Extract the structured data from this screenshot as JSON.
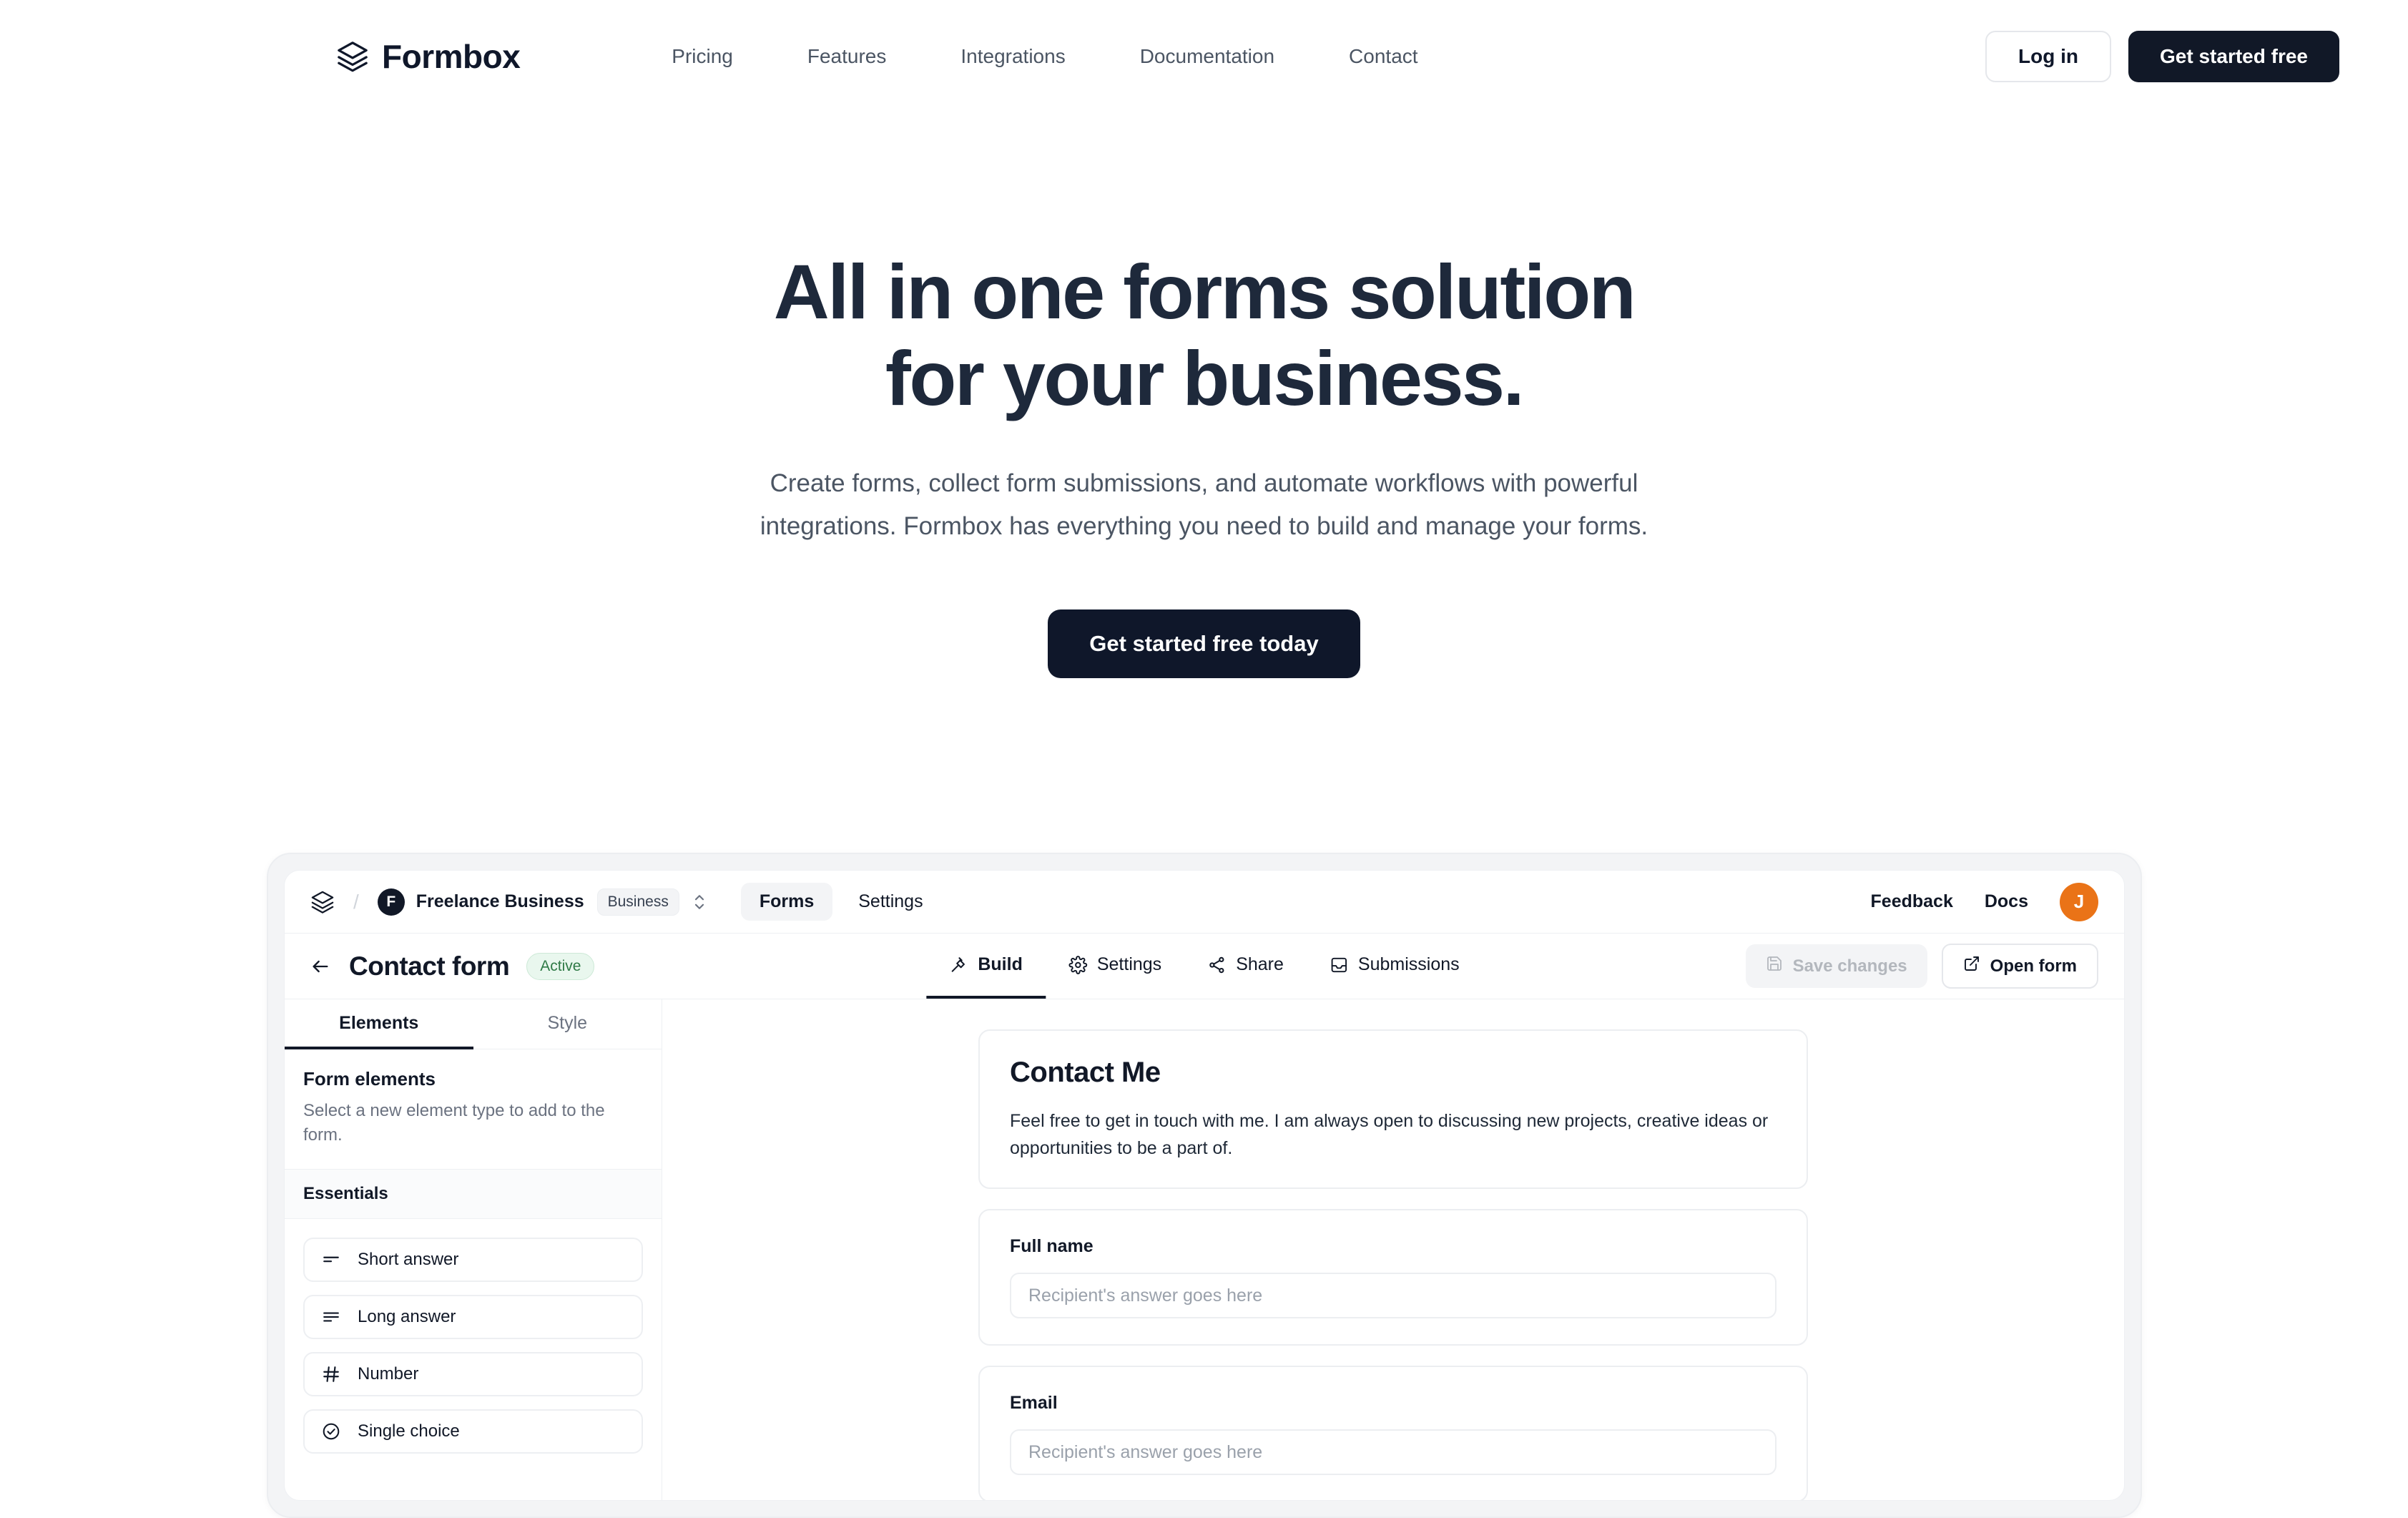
{
  "brand": {
    "name": "Formbox",
    "logo_icon": "layers-icon"
  },
  "nav": {
    "links": [
      {
        "label": "Pricing"
      },
      {
        "label": "Features"
      },
      {
        "label": "Integrations"
      },
      {
        "label": "Documentation"
      },
      {
        "label": "Contact"
      }
    ],
    "login_label": "Log in",
    "signup_label": "Get started free"
  },
  "hero": {
    "headline_line1": "All in one forms solution",
    "headline_line2": "for your business.",
    "subtitle": "Create forms, collect form submissions, and automate workflows with powerful integrations. Formbox has everything you need to build and manage your forms.",
    "cta_label": "Get started free today"
  },
  "app": {
    "topbar": {
      "logo_icon": "layers-icon",
      "separator": "/",
      "org_initial": "F",
      "org_name": "Freelance Business",
      "plan_chip": "Business",
      "switcher_icon": "chevron-up-down-icon",
      "tabs": [
        {
          "label": "Forms",
          "active": true
        },
        {
          "label": "Settings",
          "active": false
        }
      ],
      "feedback_label": "Feedback",
      "docs_label": "Docs",
      "user_initial": "J",
      "user_avatar_color": "#ea7317"
    },
    "form_header": {
      "back_icon": "arrow-left-icon",
      "title": "Contact form",
      "status": "Active",
      "status_color": "#2f7a46",
      "tabs": [
        {
          "label": "Build",
          "icon": "build-icon",
          "active": true
        },
        {
          "label": "Settings",
          "icon": "gear-icon",
          "active": false
        },
        {
          "label": "Share",
          "icon": "share-icon",
          "active": false
        },
        {
          "label": "Submissions",
          "icon": "inbox-icon",
          "active": false
        }
      ],
      "save_label": "Save changes",
      "save_icon": "save-disk-icon",
      "save_disabled": true,
      "open_label": "Open form",
      "open_icon": "external-link-icon"
    },
    "side_panel": {
      "tabs": [
        {
          "label": "Elements",
          "active": true
        },
        {
          "label": "Style",
          "active": false
        }
      ],
      "heading": "Form elements",
      "description": "Select a new element type to add to the form.",
      "section_label": "Essentials",
      "elements": [
        {
          "label": "Short answer",
          "icon": "short-answer-icon"
        },
        {
          "label": "Long answer",
          "icon": "long-answer-icon"
        },
        {
          "label": "Number",
          "icon": "hash-icon"
        },
        {
          "label": "Single choice",
          "icon": "check-circle-icon"
        }
      ]
    },
    "preview": {
      "title": "Contact Me",
      "description": "Feel free to get in touch with me. I am always open to discussing new projects, creative ideas or opportunities to be a part of.",
      "fields": [
        {
          "label": "Full name",
          "placeholder": "Recipient's answer goes here"
        },
        {
          "label": "Email",
          "placeholder": "Recipient's answer goes here"
        }
      ]
    }
  }
}
